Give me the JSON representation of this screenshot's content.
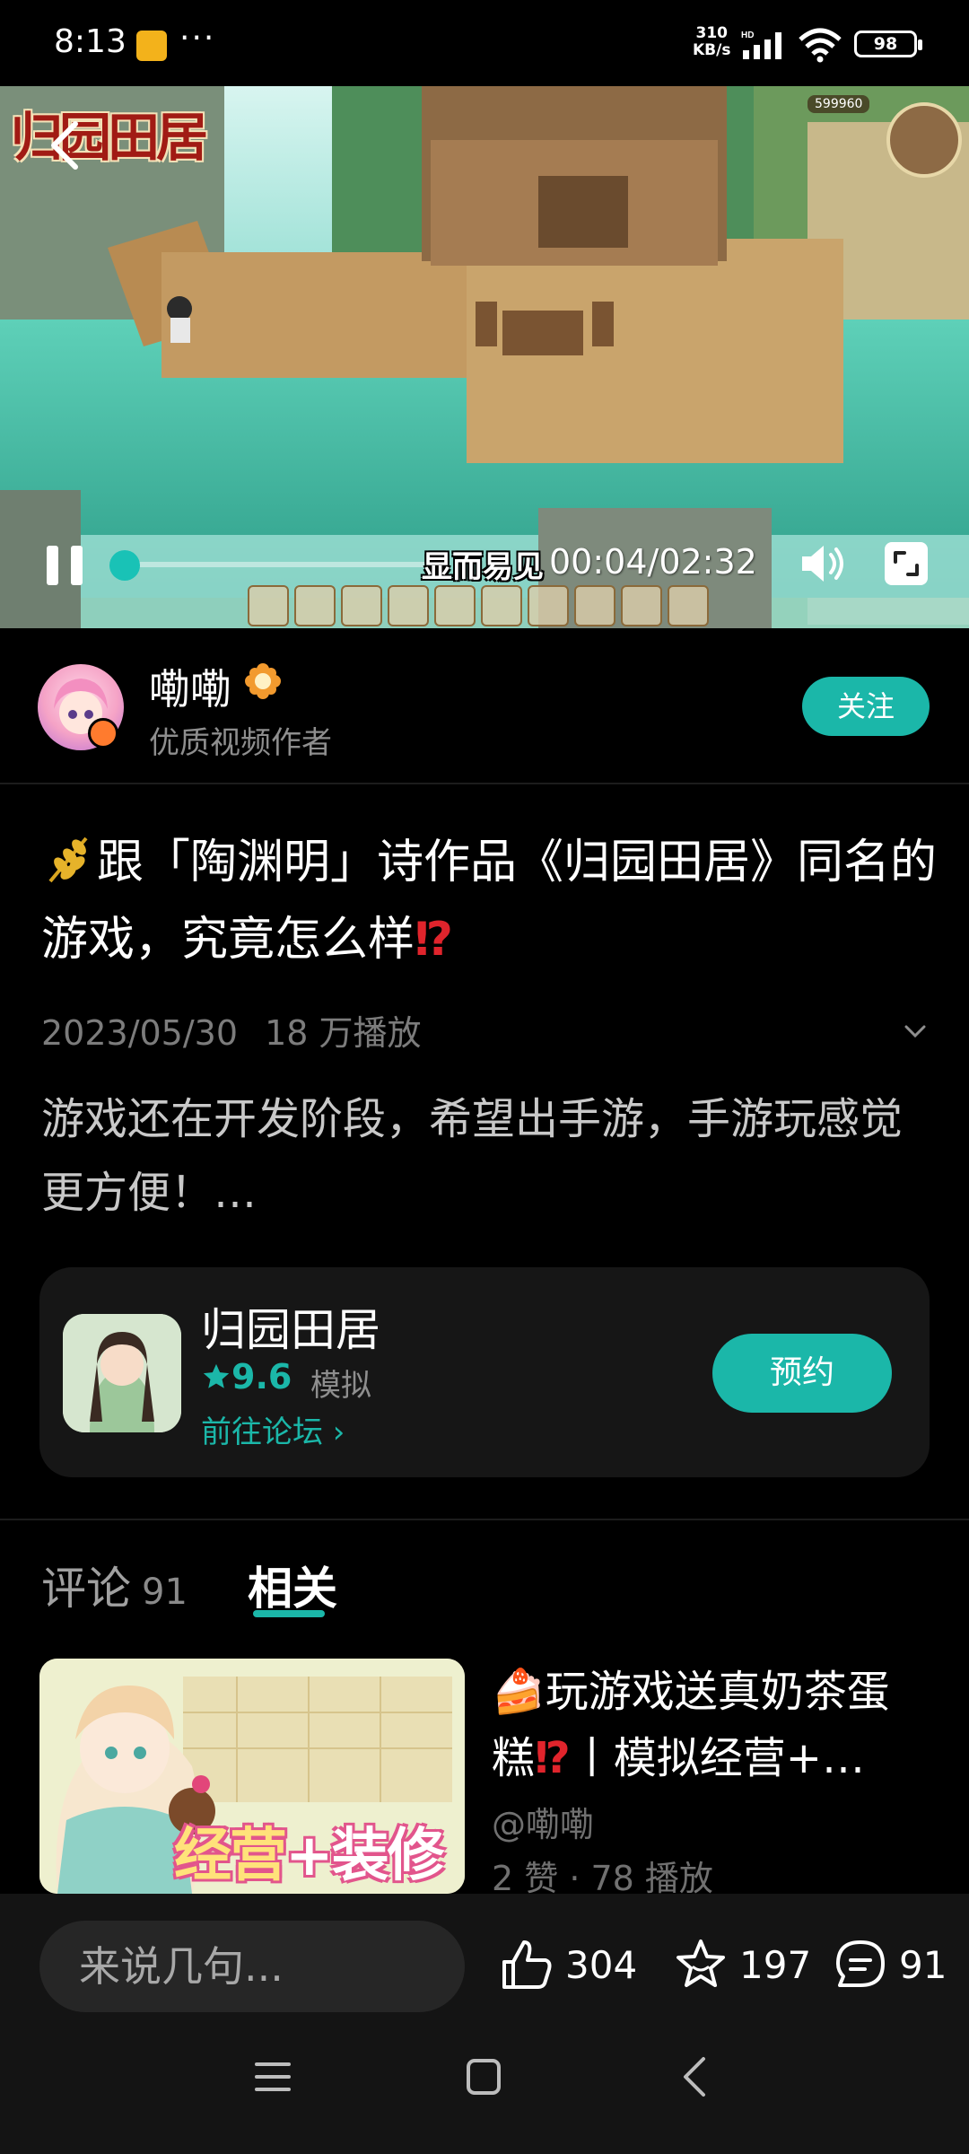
{
  "status_bar": {
    "time": "8:13",
    "dots": "···",
    "net_speed_value": "310",
    "net_speed_unit": "KB/s",
    "network_type": "HD",
    "battery": "98"
  },
  "video": {
    "game_logo": "归园田居",
    "coin_count": "599960",
    "subtitle": "显而易见",
    "time": "00:04/02:32",
    "progress": 0.03
  },
  "author": {
    "name": "嘞嘞",
    "tag": "优质视频作者",
    "follow_label": "关注"
  },
  "post": {
    "title_main": "跟「陶渊明」诗作品《归园田居》同名的游戏，究竟怎么样",
    "title_excl": "⁉",
    "date": "2023/05/30",
    "plays": "18 万播放",
    "description": "游戏还在开发阶段，希望出手游，手游玩感觉更方便！…"
  },
  "game_card": {
    "name": "归园田居",
    "rating": "9.6",
    "genre": "模拟",
    "forum_link": "前往论坛 ›",
    "reserve_label": "预约"
  },
  "tabs": {
    "comments_label": "评论",
    "comments_count": "91",
    "related_label": "相关"
  },
  "related": {
    "title_prefix": "🍰",
    "title_part1": "玩游戏送真奶茶蛋糕",
    "title_excl": "⁉",
    "title_part2": "丨模拟经营+…",
    "author": "@嘞嘞",
    "stats": "2 赞 · 78 播放",
    "thumb_text_a": "经营",
    "thumb_text_b": "+装修"
  },
  "bottom_bar": {
    "comment_placeholder": "来说几句...",
    "likes": "304",
    "favorites": "197",
    "comments": "91"
  },
  "colors": {
    "accent": "#1bb7a9",
    "background": "#000000",
    "alert_red": "#e0242c"
  },
  "icons": [
    "back-icon",
    "pause-icon",
    "volume-icon",
    "fullscreen-icon",
    "star-icon",
    "like-icon",
    "favorite-icon",
    "comment-icon",
    "nav-menu-icon",
    "nav-home-icon",
    "nav-back-icon",
    "chevron-down-icon"
  ]
}
